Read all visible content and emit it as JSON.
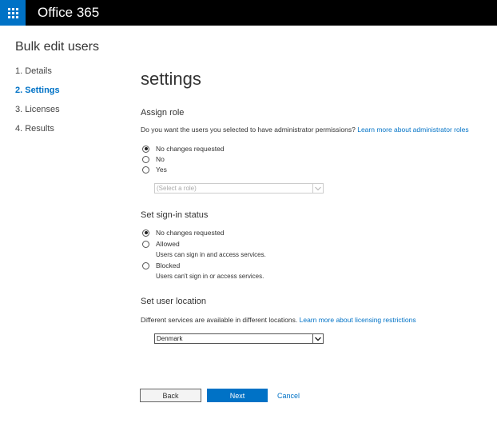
{
  "app": {
    "title": "Office 365"
  },
  "page": {
    "title": "Bulk edit users"
  },
  "steps": [
    {
      "label": "1.  Details"
    },
    {
      "label": "2.  Settings"
    },
    {
      "label": "3.  Licenses"
    },
    {
      "label": "4.  Results"
    }
  ],
  "content": {
    "title": "settings"
  },
  "assign_role": {
    "title": "Assign role",
    "question": "Do you want the users you selected to have administrator permissions?",
    "link": "Learn more about administrator roles",
    "options": [
      "No changes requested",
      "No",
      "Yes"
    ],
    "role_select": {
      "value": "(Select a role)"
    }
  },
  "signin_status": {
    "title": "Set sign-in status",
    "options": [
      {
        "label": "No changes requested"
      },
      {
        "label": "Allowed",
        "note": "Users can sign in and access services."
      },
      {
        "label": "Blocked",
        "note": "Users can't sign in or access services."
      }
    ]
  },
  "location": {
    "title": "Set user location",
    "description": "Different services are available in different locations.",
    "link": "Learn more about licensing restrictions",
    "select": {
      "value": "Denmark"
    }
  },
  "footer": {
    "back_label": "Back",
    "next_label": "Next",
    "cancel_label": "Cancel"
  }
}
